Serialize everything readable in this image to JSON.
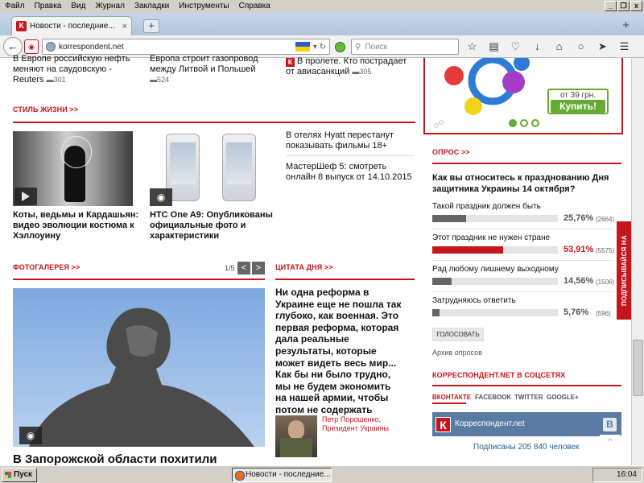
{
  "menubar": {
    "items": [
      "Файл",
      "Правка",
      "Вид",
      "Журнал",
      "Закладки",
      "Инструменты",
      "Справка"
    ]
  },
  "window_buttons": {
    "minimize": "_",
    "restore": "❐",
    "close": "x"
  },
  "tabs": {
    "active_title": "Новости - последние...",
    "close": "×",
    "new_tab": "+",
    "list_all": "+"
  },
  "navbar": {
    "url": "korrespondent.net",
    "search_placeholder": "Поиск"
  },
  "top_news": [
    {
      "text": "В Европе российскую нефть меняют на саудовскую - Reuters",
      "comments": "301"
    },
    {
      "text": "Европа строит газопровод между Литвой и Польшей",
      "comments": "524"
    },
    {
      "text": "В пролете. Кто пострадает от авиасанкций",
      "comments": "305"
    }
  ],
  "lifestyle": {
    "header": "СТИЛЬ ЖИЗНИ >>",
    "card1": "Коты, ведьмы и Кардашьян: видео эволюции костюма к Хэллоуину",
    "card2": "HTC One A9: Опубликованы официальные фото и характеристики",
    "side1": "В отелях Hyatt перестанут показывать фильмы 18+",
    "side2": "МастерШеф 5: смотреть онлайн 8 выпуск от 14.10.2015"
  },
  "gallery": {
    "header": "ФОТОГАЛЕРЕЯ >>",
    "pager": "1/5",
    "prev": "<",
    "next": ">",
    "caption": "В Запорожской области похитили"
  },
  "quote": {
    "header": "ЦИТАТА ДНЯ >>",
    "text": "Ни одна реформа в Украине еще не пошла так глубоко, как военная. Это первая реформа, которая дала реальные результаты, которые может видеть весь мир... Как бы ни было трудно, мы не будем экономить на нашей армии, чтобы потом не содержать чужую",
    "author": "Петр Порошенко, Президент Украины"
  },
  "ad": {
    "price": "от 39 грн.",
    "button": "Купить!"
  },
  "poll": {
    "header": "ОПРОС >>",
    "question": "Как вы относитесь к празднованию Дня защитника Украины 14 октября?",
    "options": [
      {
        "label": "Такой праздник должен быть",
        "percent": "25,76%",
        "votes": "(2664)",
        "fraction": 0.2576,
        "color": "#666666"
      },
      {
        "label": "Этот праздник не нужен стране",
        "percent": "53,91%",
        "votes": "(5575)",
        "fraction": 0.5391,
        "color": "#c4161c"
      },
      {
        "label": "Рад любому лишнему выходному",
        "percent": "14,56%",
        "votes": "(1506)",
        "fraction": 0.1456,
        "color": "#666666"
      },
      {
        "label": "Затрудняюсь ответить",
        "percent": "5,76%",
        "votes": "(596)",
        "fraction": 0.0576,
        "color": "#666666"
      }
    ],
    "vote_button": "ГОЛОСОВАТЬ",
    "archive": "Архив опросов"
  },
  "subscribe": "ПОДПИСЫВАЙСЯ НА ЖУРНАЛ",
  "social": {
    "header": "КОРРЕСПОНДЕНТ.NET В СОЦСЕТЯХ",
    "tabs": [
      "ВКОНТАКТЕ",
      "FACEBOOK",
      "TWITTER",
      "GOOGLE+"
    ],
    "vk_name": "Корреспондент.net",
    "vk_logo": "К",
    "vk_button": "В",
    "subscribers": "Подписаны 205 840 человек"
  },
  "taskbar": {
    "start": "Пуск",
    "task": "Новости - последние...",
    "clock": "16:04"
  },
  "colors": {
    "accent": "#c4161c",
    "vk": "#5a7ca3",
    "price_green": "#66aa33"
  }
}
